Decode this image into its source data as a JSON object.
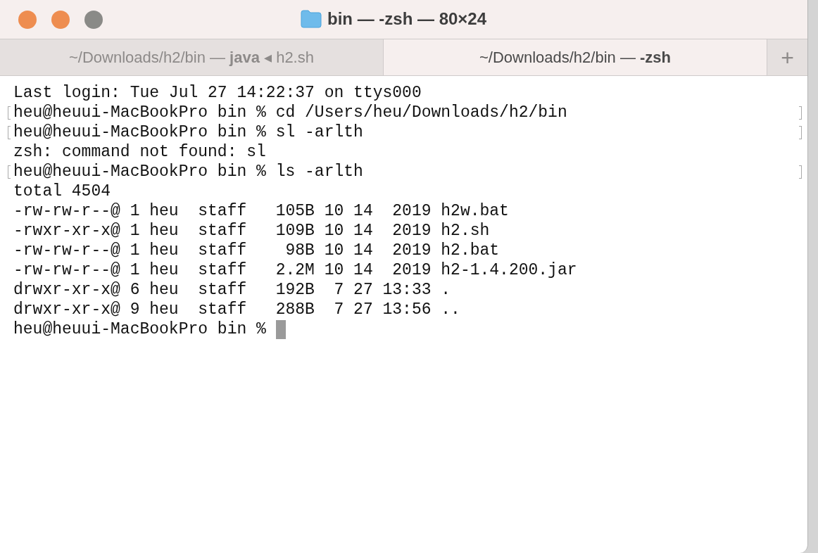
{
  "window": {
    "title": "bin — -zsh — 80×24"
  },
  "tabs": [
    {
      "label": "~/Downloads/h2/bin — **java** ◂ h2.sh",
      "selected": false
    },
    {
      "label": "~/Downloads/h2/bin — **-zsh**",
      "selected": true
    }
  ],
  "new_tab_button": "+",
  "terminal": {
    "lines": [
      {
        "text": "Last login: Tue Jul 27 14:22:37 on ttys000",
        "marked": false,
        "cursor": false
      },
      {
        "text": "heu@heuui-MacBookPro bin % cd /Users/heu/Downloads/h2/bin",
        "marked": true,
        "cursor": false
      },
      {
        "text": "heu@heuui-MacBookPro bin % sl -arlth",
        "marked": true,
        "cursor": false
      },
      {
        "text": "zsh: command not found: sl",
        "marked": false,
        "cursor": false
      },
      {
        "text": "heu@heuui-MacBookPro bin % ls -arlth",
        "marked": true,
        "cursor": false
      },
      {
        "text": "total 4504",
        "marked": false,
        "cursor": false
      },
      {
        "text": "-rw-rw-r--@ 1 heu  staff   105B 10 14  2019 h2w.bat",
        "marked": false,
        "cursor": false
      },
      {
        "text": "-rwxr-xr-x@ 1 heu  staff   109B 10 14  2019 h2.sh",
        "marked": false,
        "cursor": false
      },
      {
        "text": "-rw-rw-r--@ 1 heu  staff    98B 10 14  2019 h2.bat",
        "marked": false,
        "cursor": false
      },
      {
        "text": "-rw-rw-r--@ 1 heu  staff   2.2M 10 14  2019 h2-1.4.200.jar",
        "marked": false,
        "cursor": false
      },
      {
        "text": "drwxr-xr-x@ 6 heu  staff   192B  7 27 13:33 .",
        "marked": false,
        "cursor": false
      },
      {
        "text": "drwxr-xr-x@ 9 heu  staff   288B  7 27 13:56 ..",
        "marked": false,
        "cursor": false
      },
      {
        "text": "heu@heuui-MacBookPro bin % ",
        "marked": false,
        "cursor": true
      }
    ]
  }
}
